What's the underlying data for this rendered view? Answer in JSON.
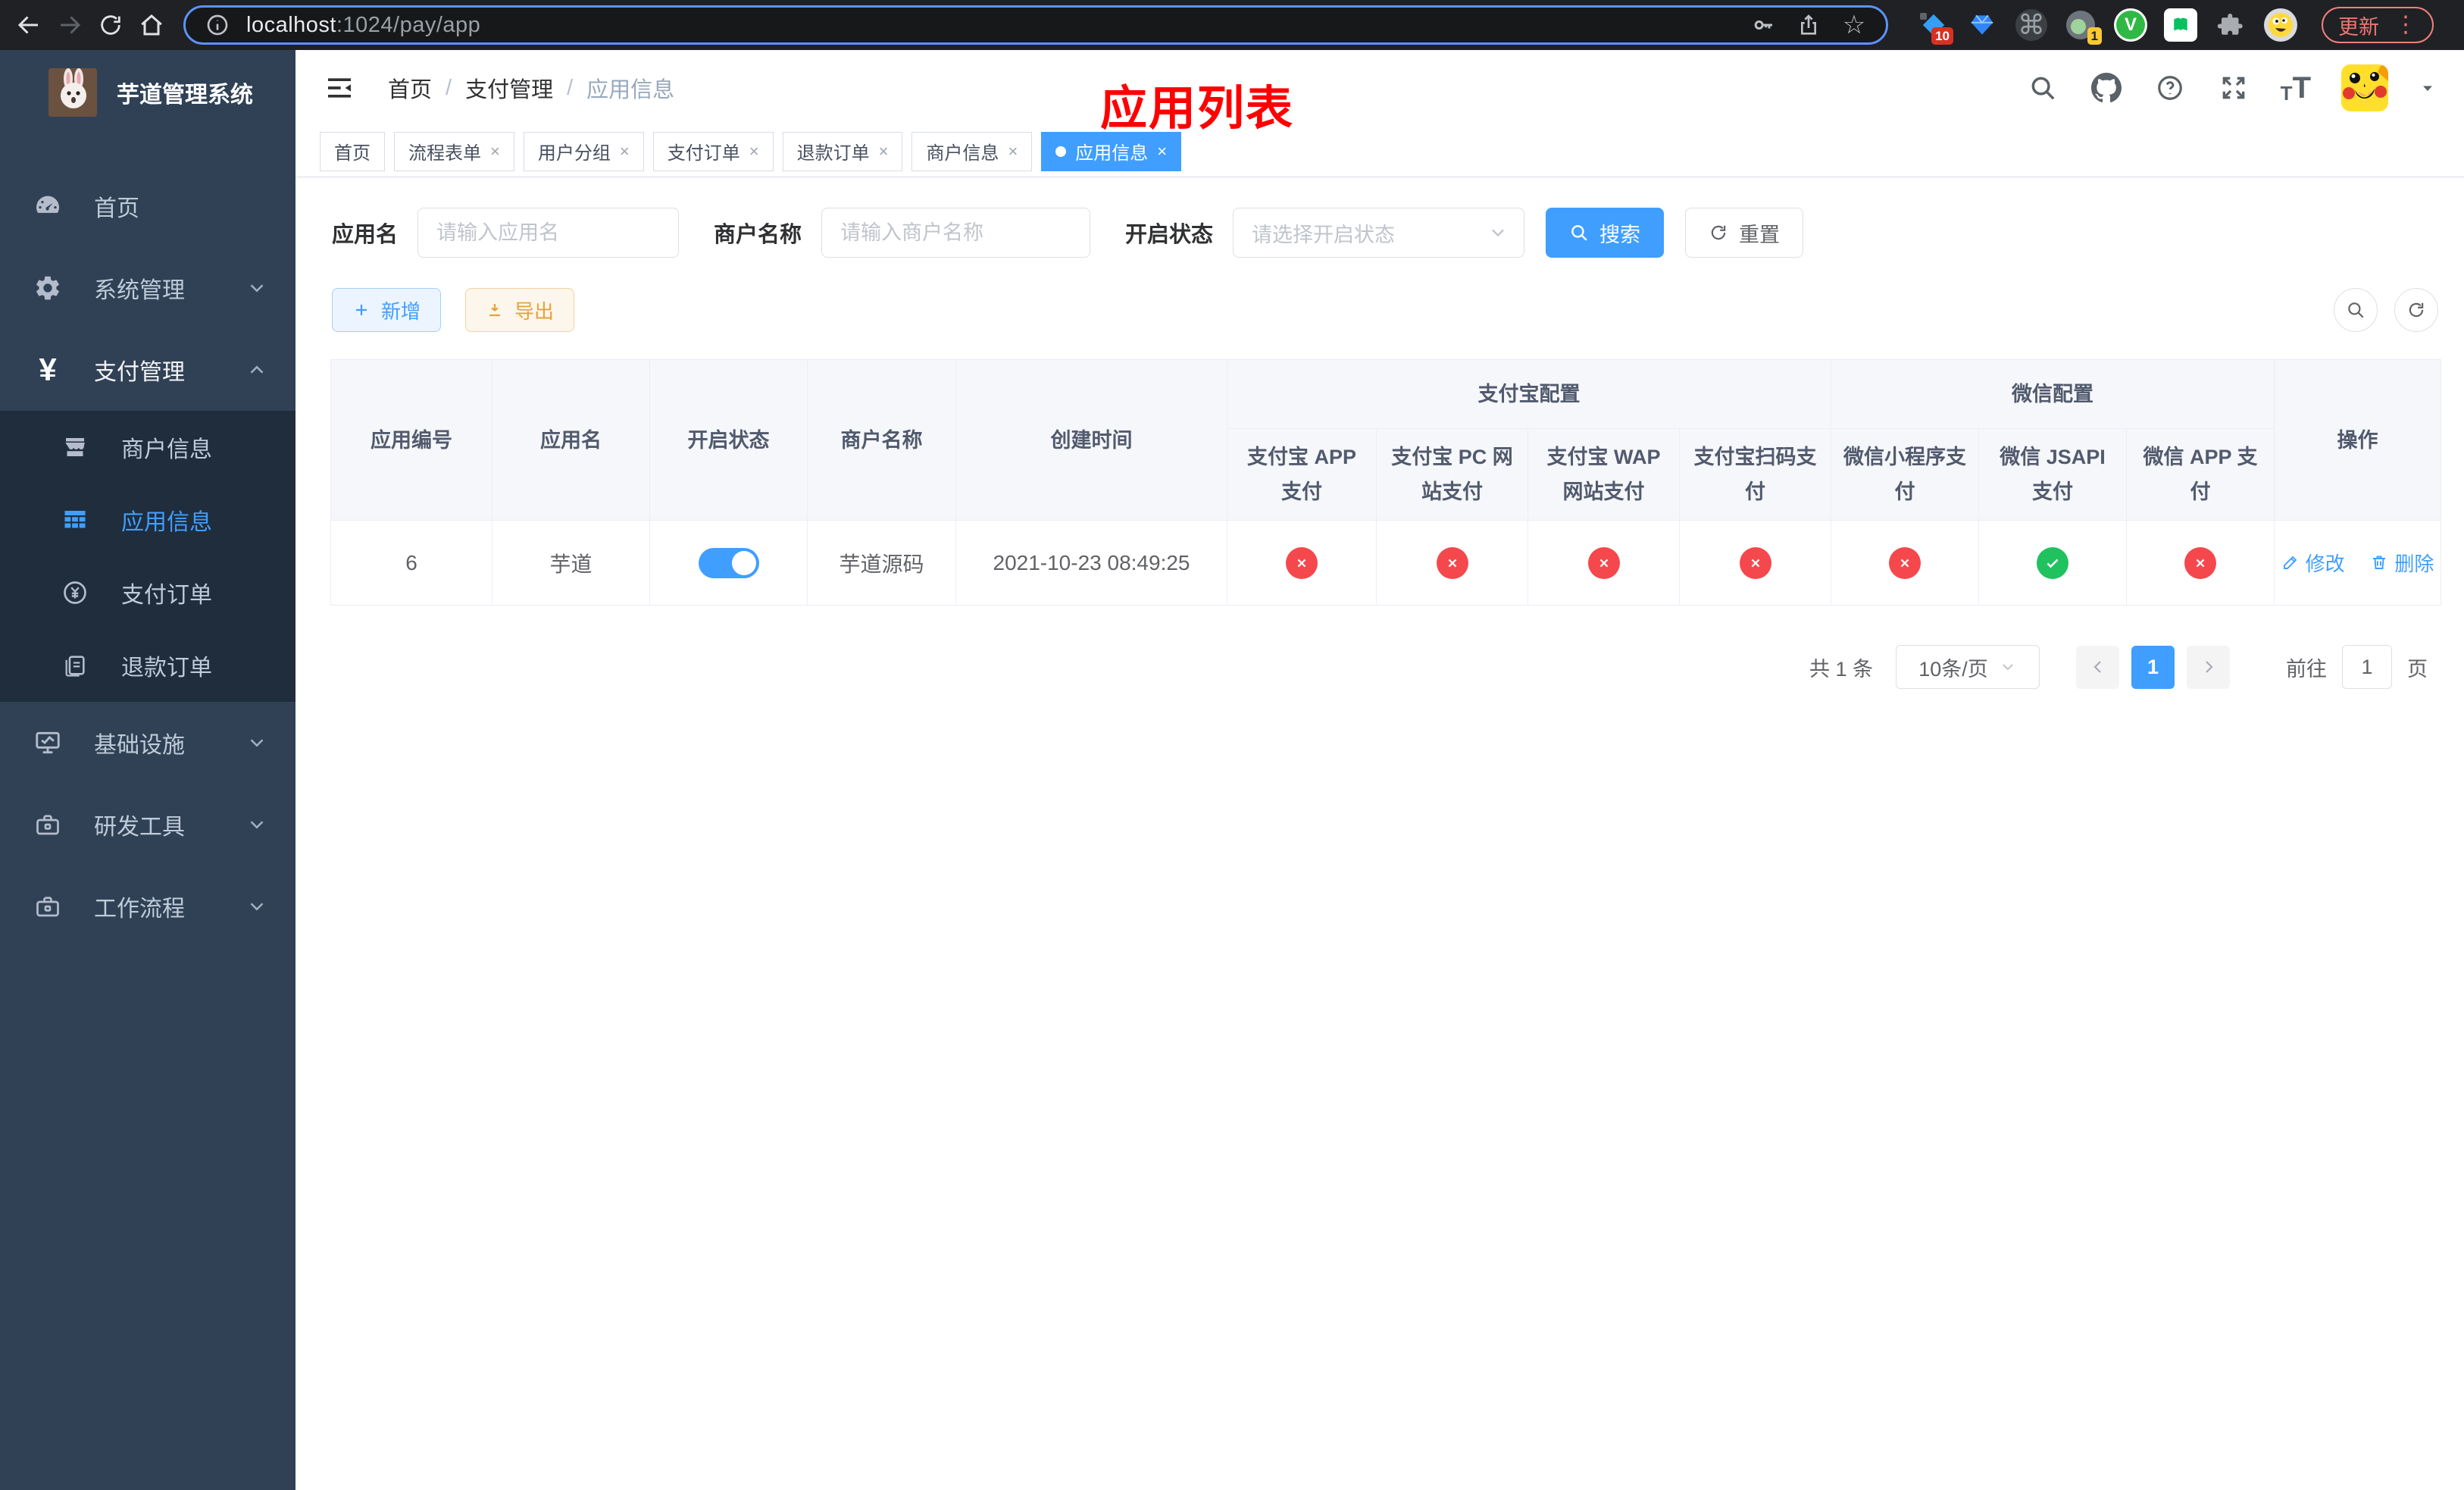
{
  "colors": {
    "accent": "#409eff",
    "success": "#1fc25f",
    "danger": "#f5484c",
    "warning": "#e6a23c",
    "annotation": "#ff0000",
    "sidebar-bg": "#304156",
    "submenu-bg": "#1f2d3d"
  },
  "browser": {
    "url_host": "localhost",
    "url_path": ":1024/pay/app",
    "update_label": "更新",
    "ext_badge_count": "10",
    "avatar_badge_count": "1"
  },
  "sidebar": {
    "app_title": "芋道管理系统",
    "items": [
      {
        "label": "首页"
      },
      {
        "label": "系统管理"
      },
      {
        "label": "支付管理"
      },
      {
        "label": "商户信息"
      },
      {
        "label": "应用信息"
      },
      {
        "label": "支付订单"
      },
      {
        "label": "退款订单"
      },
      {
        "label": "基础设施"
      },
      {
        "label": "研发工具"
      },
      {
        "label": "工作流程"
      }
    ]
  },
  "breadcrumb": {
    "items": [
      "首页",
      "支付管理",
      "应用信息"
    ]
  },
  "annotation": {
    "title": "应用列表"
  },
  "tabs": [
    {
      "label": "首页"
    },
    {
      "label": "流程表单"
    },
    {
      "label": "用户分组"
    },
    {
      "label": "支付订单"
    },
    {
      "label": "退款订单"
    },
    {
      "label": "商户信息"
    },
    {
      "label": "应用信息"
    }
  ],
  "filters": {
    "app_name_label": "应用名",
    "app_name_placeholder": "请输入应用名",
    "merchant_label": "商户名称",
    "merchant_placeholder": "请输入商户名称",
    "status_label": "开启状态",
    "status_placeholder": "请选择开启状态",
    "search_label": "搜索",
    "reset_label": "重置"
  },
  "toolbar": {
    "add_label": "新增",
    "export_label": "导出"
  },
  "table": {
    "group_alipay": "支付宝配置",
    "group_wechat": "微信配置",
    "col_app_id": "应用编号",
    "col_app_name": "应用名",
    "col_status": "开启状态",
    "col_merchant": "商户名称",
    "col_created": "创建时间",
    "col_alipay_app": "支付宝 APP 支付",
    "col_alipay_pc": "支付宝 PC 网站支付",
    "col_alipay_wap": "支付宝 WAP 网站支付",
    "col_alipay_qr": "支付宝扫码支付",
    "col_wx_mini": "微信小程序支付",
    "col_wx_jsapi": "微信 JSAPI 支付",
    "col_wx_app": "微信 APP 支付",
    "col_actions": "操作",
    "row": {
      "app_id": "6",
      "app_name": "芋道",
      "status_on": true,
      "merchant": "芋道源码",
      "created": "2021-10-23 08:49:25",
      "alipay_app": false,
      "alipay_pc": false,
      "alipay_wap": false,
      "alipay_qr": false,
      "wx_mini": false,
      "wx_jsapi": true,
      "wx_app": false,
      "edit_label": "修改",
      "delete_label": "删除"
    }
  },
  "pagination": {
    "total_label": "共 1 条",
    "page_size": "10条/页",
    "current_page": "1",
    "goto_label": "前往",
    "goto_value": "1",
    "page_label": "页"
  }
}
